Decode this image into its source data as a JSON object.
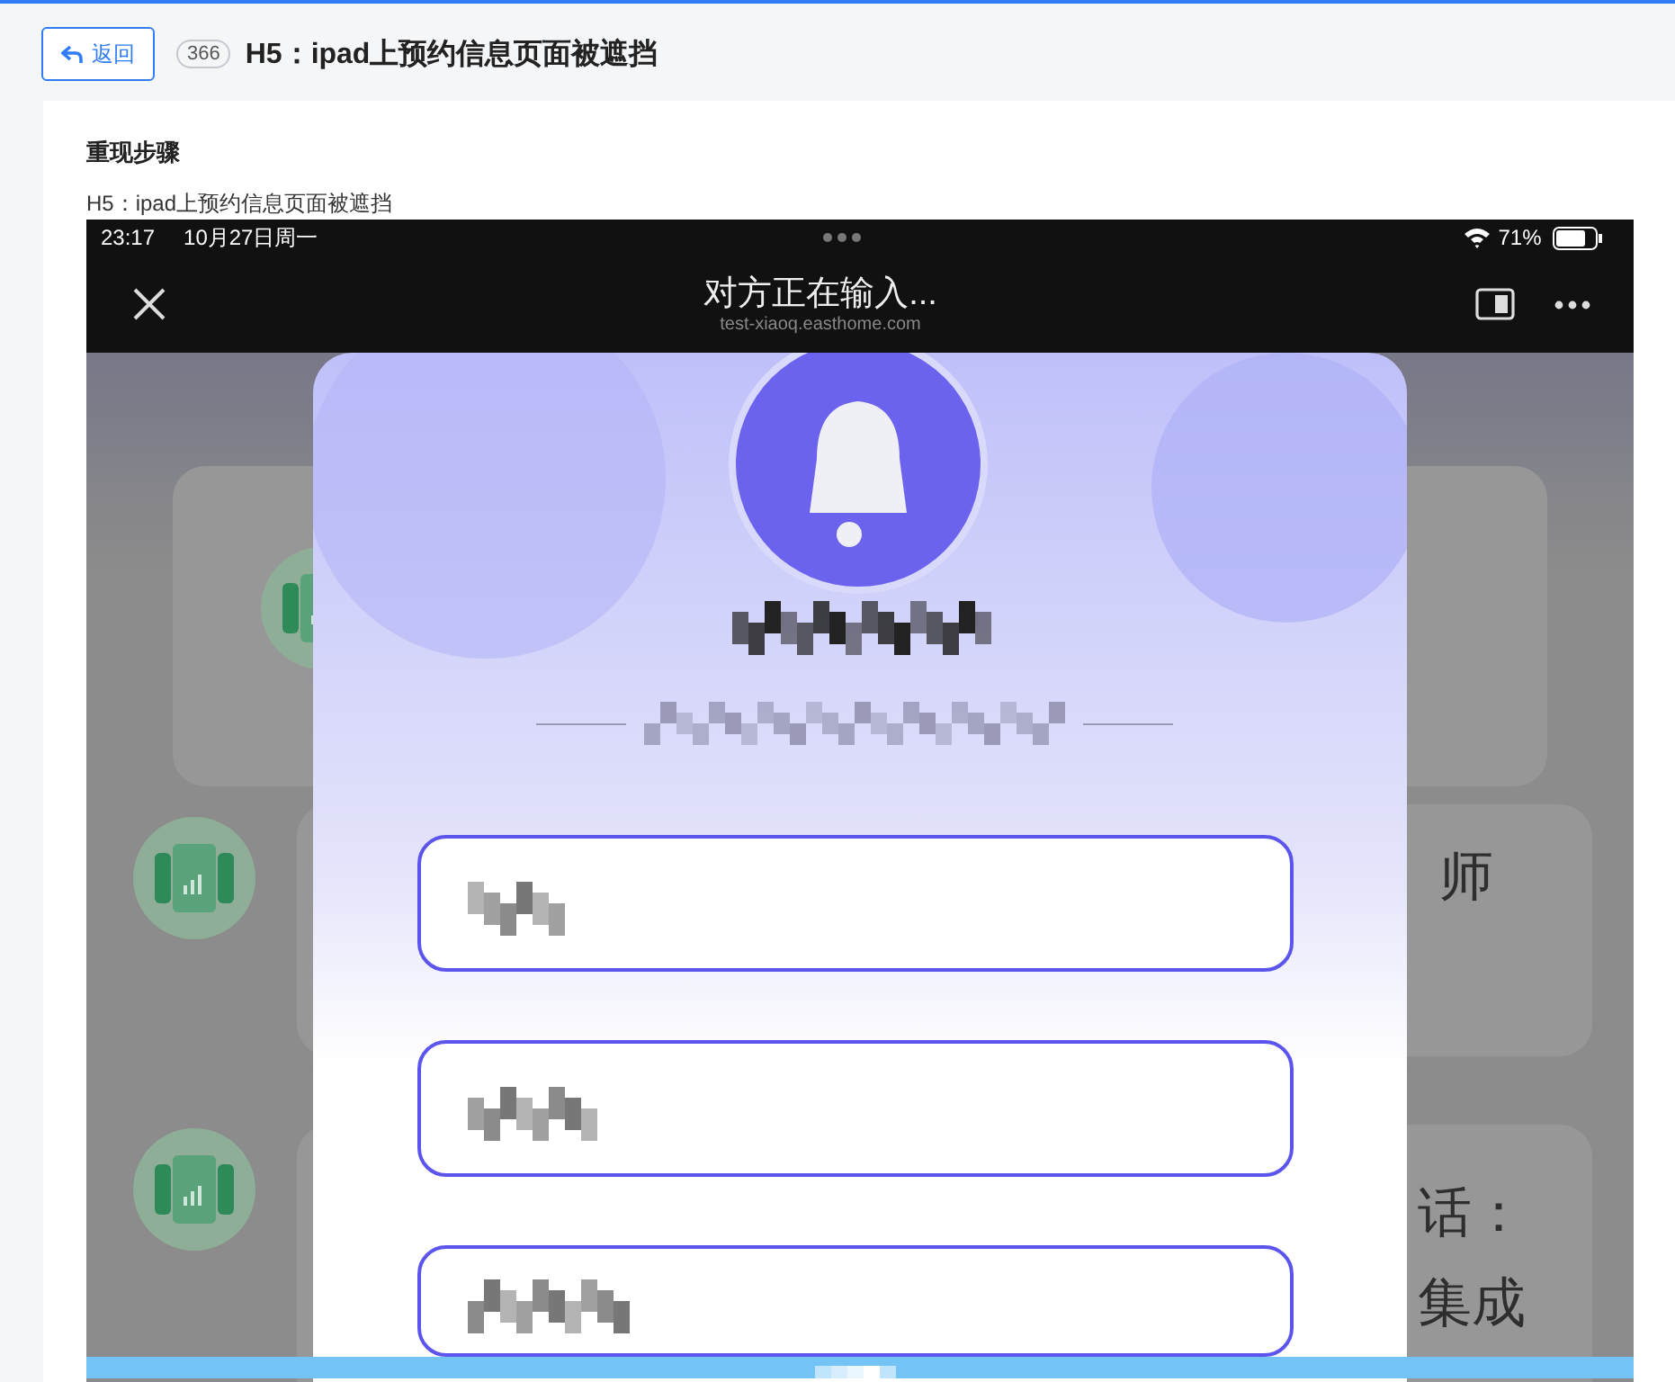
{
  "back_button": {
    "label": "返回"
  },
  "issue": {
    "number": "366",
    "title": "H5：ipad上预约信息页面被遮挡"
  },
  "section": {
    "heading": "重现步骤",
    "description": "H5：ipad上预约信息页面被遮挡"
  },
  "screenshot": {
    "status_bar": {
      "time": "23:17",
      "date": "10月27日周一",
      "battery": "71%"
    },
    "nav": {
      "title": "对方正在输入...",
      "url": "test-xiaoq.easthome.com"
    },
    "background_texts": [
      "师",
      "话：",
      "集成"
    ],
    "fields": [
      {
        "kind": "pixelated"
      },
      {
        "kind": "pixelated"
      },
      {
        "kind": "pixelated"
      }
    ]
  }
}
